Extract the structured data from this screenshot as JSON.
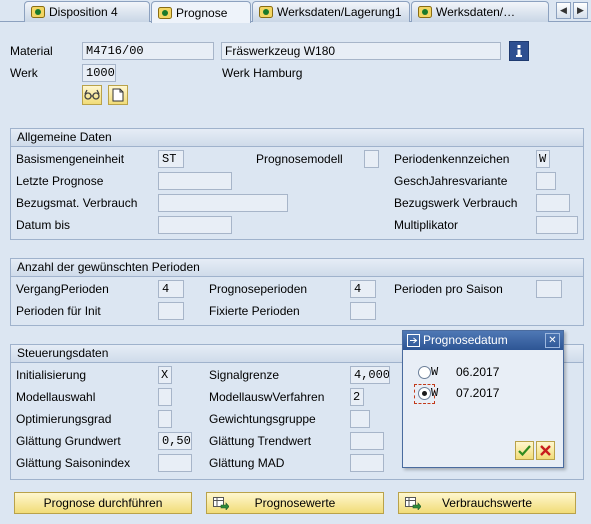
{
  "tabs": [
    {
      "label": "Disposition 4",
      "active": false
    },
    {
      "label": "Prognose",
      "active": true
    },
    {
      "label": "Werksdaten/Lagerung1",
      "active": false
    },
    {
      "label": "Werksdaten/…",
      "active": false
    }
  ],
  "nav": {
    "prev": "◀",
    "next": "▶"
  },
  "header": {
    "material_label": "Material",
    "material_value": "M4716/00",
    "material_desc": "Fräswerkzeug W180",
    "werk_label": "Werk",
    "werk_value": "1000",
    "werk_desc": "Werk Hamburg"
  },
  "allgemein": {
    "title": "Allgemeine Daten",
    "basismenge_label": "Basismengeneinheit",
    "basismenge_value": "ST",
    "prognosemodell_label": "Prognosemodell",
    "prognosemodell_value": "",
    "periodenkz_label": "Periodenkennzeichen",
    "periodenkz_value": "W",
    "letzte_label": "Letzte Prognose",
    "letzte_value": "",
    "geschjahr_label": "GeschJahresvariante",
    "geschjahr_value": "",
    "bezugsmat_label": "Bezugsmat. Verbrauch",
    "bezugsmat_value": "",
    "bezugswerk_label": "Bezugswerk Verbrauch",
    "bezugswerk_value": "",
    "datumbis_label": "Datum bis",
    "datumbis_value": "",
    "multi_label": "Multiplikator",
    "multi_value": ""
  },
  "anzahl": {
    "title": "Anzahl der gewünschten Perioden",
    "vergang_label": "VergangPerioden",
    "vergang_value": "4",
    "progper_label": "Prognoseperioden",
    "progper_value": "4",
    "saison_label": "Perioden pro Saison",
    "saison_value": "",
    "init_label": "Perioden für Init",
    "init_value": "",
    "fixiert_label": "Fixierte Perioden",
    "fixiert_value": ""
  },
  "steuerung": {
    "title": "Steuerungsdaten",
    "init_label": "Initialisierung",
    "init_value": "X",
    "signal_label": "Signalgrenze",
    "signal_value": "4,000",
    "modellaus_label": "Modellauswahl",
    "modellaus_value": "",
    "modverf_label": "ModellauswVerfahren",
    "modverf_value": "2",
    "optgrad_label": "Optimierungsgrad",
    "optgrad_value": "",
    "gewicht_label": "Gewichtungsgruppe",
    "gewicht_value": "",
    "glgrund_label": "Glättung Grundwert",
    "glgrund_value": "0,50",
    "gltrend_label": "Glättung Trendwert",
    "gltrend_value": "",
    "glsaison_label": "Glättung Saisonindex",
    "glsaison_value": "",
    "glmad_label": "Glättung MAD",
    "glmad_value": ""
  },
  "buttons": {
    "durchfuehren": "Prognose durchführen",
    "werte": "Prognosewerte",
    "verbrauch": "Verbrauchswerte"
  },
  "popup": {
    "title": "Prognosedatum",
    "close": "✕",
    "options": [
      {
        "code": "W",
        "date": "06.2017",
        "selected": false
      },
      {
        "code": "W",
        "date": "07.2017",
        "selected": true
      }
    ]
  },
  "colors": {
    "accent_yellow": "#f1dc78",
    "title_blue": "#2d5594",
    "bg": "#dce6f2"
  }
}
